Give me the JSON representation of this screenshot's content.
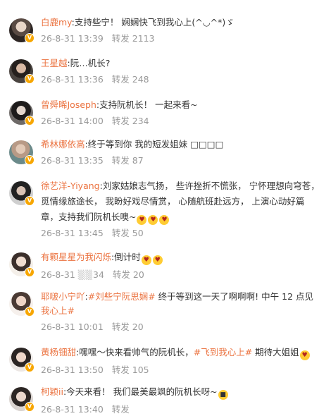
{
  "comments": [
    {
      "user": "白鹿my",
      "content": "支持些宁！ 娴娴快飞到我心上",
      "content_tail": "(^◡^*)ゞ",
      "date": "26-8-31 13:39",
      "repost": "转发 2113",
      "avatar_icon": "avatar-icon"
    },
    {
      "user": "王星越",
      "content": "阮…机长?",
      "date": "26-8-31 13:36",
      "repost": "转发 248",
      "avatar_icon": "avatar-icon"
    },
    {
      "user": "曾舜晞Joseph",
      "content": "支持阮机长！ 一起来看~",
      "date": "26-8-31 14:00",
      "repost": "转发 234",
      "avatar_icon": "avatar-icon"
    },
    {
      "user": "希林娜依高",
      "content": "终于等到你 我的短发姐妹 ",
      "content_tail": "□□□□",
      "date": "26-8-31 13:35",
      "repost": "转发 87",
      "avatar_icon": "avatar-icon"
    },
    {
      "user": "徐艺洋-Yiyang",
      "content": "刘家姑娘志气扬， 些许挫折不慌张， 宁怀理想向穹苍，觅情缘旅途长， 我盼好戏尽情赏， 心随航班赴远方， 上演心动好篇章，支持我们阮机长噢~",
      "date": "26-8-31 13:45",
      "repost": "转发 50",
      "avatar_icon": "avatar-icon"
    },
    {
      "user": "有颗星星为我闪烁",
      "content": "倒计时",
      "date_visible": "26-8-31",
      "date_tail": "34",
      "repost": "转发 20",
      "avatar_icon": "avatar-icon"
    },
    {
      "user": "耶啵小宁吖",
      "tag": "#刘些宁阮思娴#",
      "content": " 终于等到这一天了啊啊啊! 中午 12 点见",
      "tag2": "我心上#",
      "date": "26-8-31 10:01",
      "repost": "转发 20",
      "avatar_icon": "avatar-icon"
    },
    {
      "user": "黄杨钿甜",
      "content": "嘿嘿～快来看帅气的阮机长，",
      "tag": "#飞到我心上#",
      "content_tail": " 期待大姐姐",
      "date": "26-8-31 13:50",
      "repost": "转发 105",
      "avatar_icon": "avatar-icon"
    },
    {
      "user": "柯颖ii",
      "content": "今天来看！ 我们最美最飒的阮机长呀~",
      "date": "26-8-31 13:40",
      "repost": "转发",
      "avatar_icon": "avatar-icon"
    }
  ],
  "separator": ":",
  "badge_label": "V",
  "colors": {
    "name": "#eb7340",
    "meta": "#999999",
    "badge": "#f7a600"
  }
}
